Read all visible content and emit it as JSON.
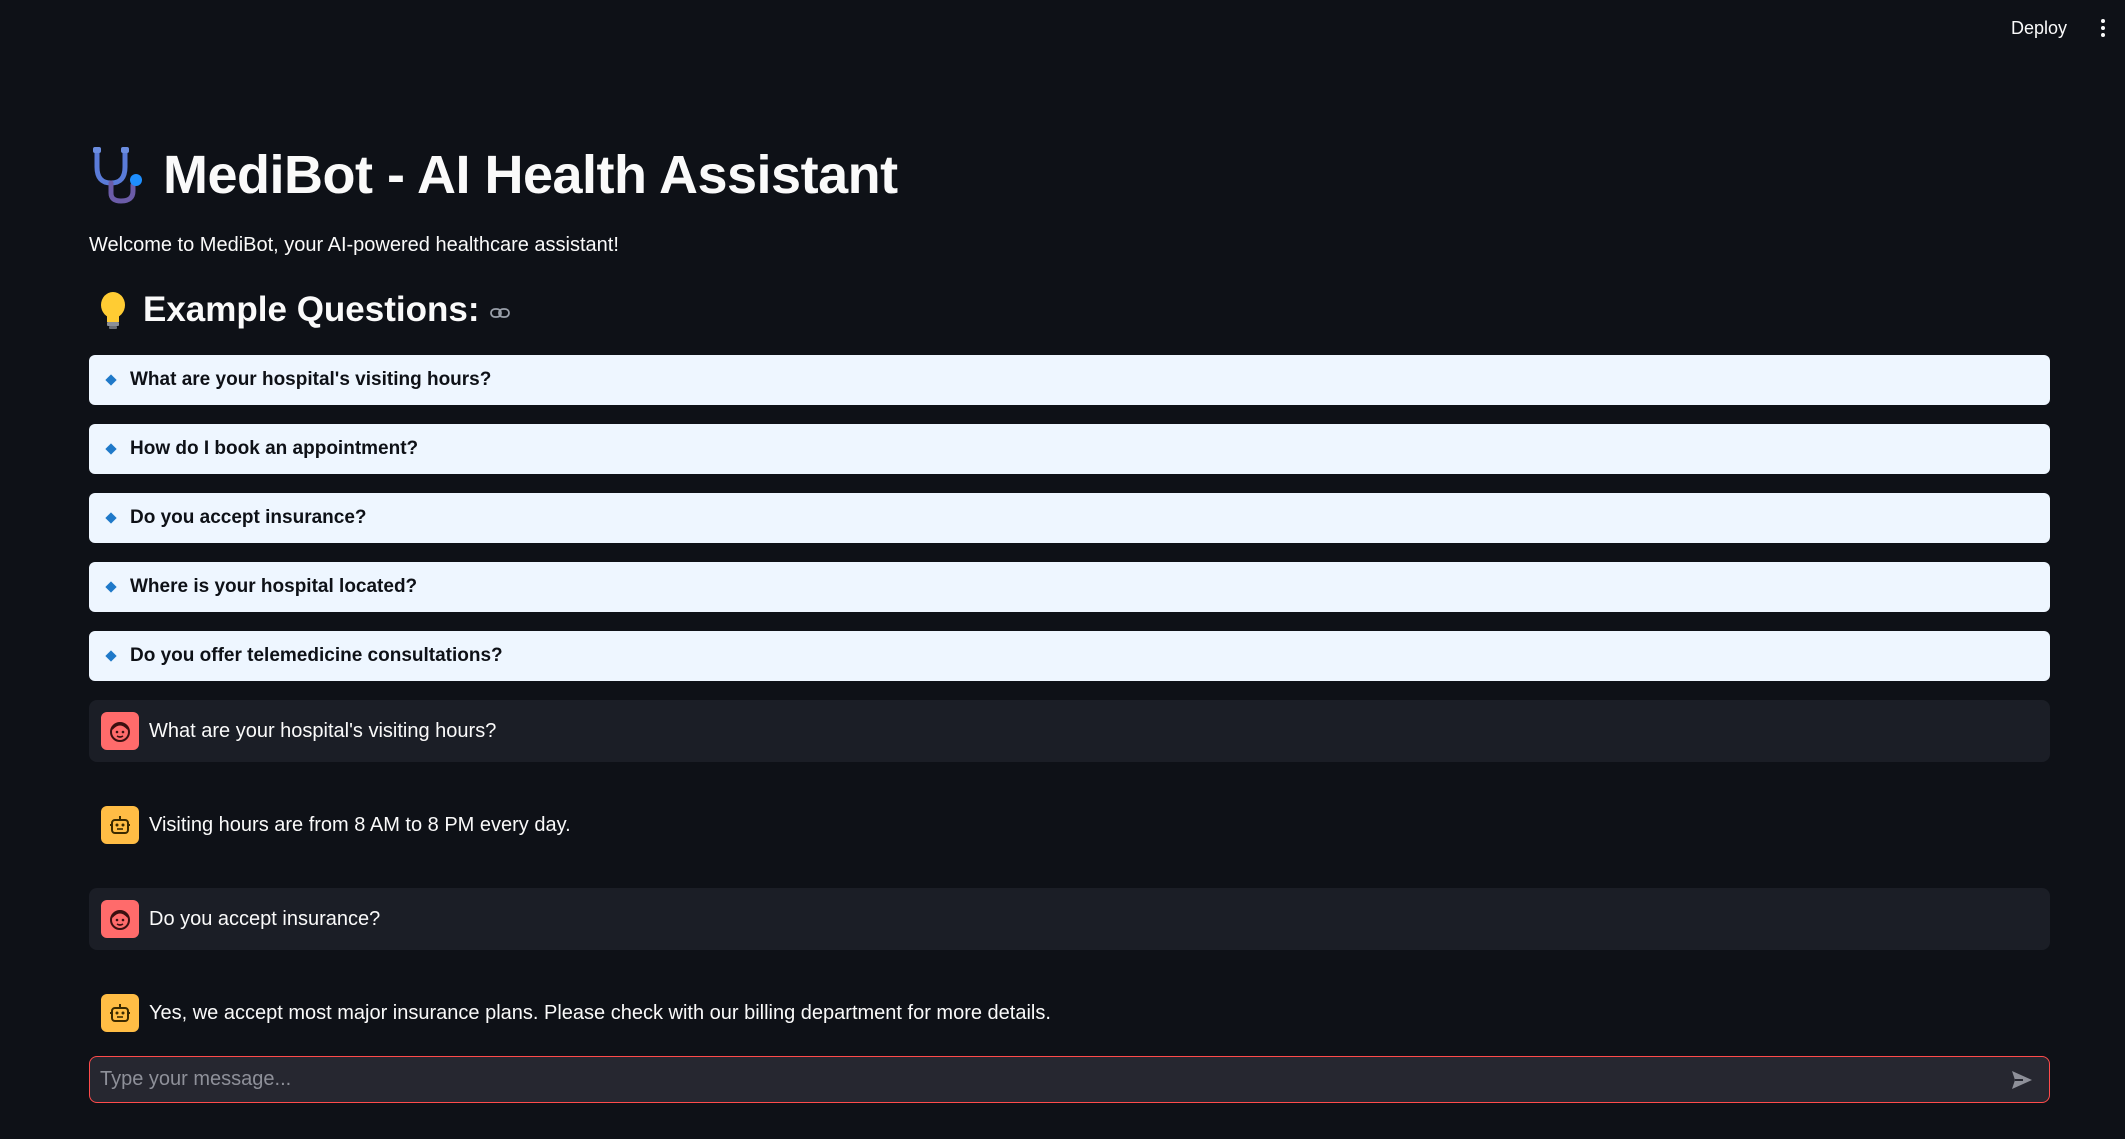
{
  "header": {
    "deploy_label": "Deploy",
    "menu_icon": "kebab-menu-icon"
  },
  "app": {
    "title": "MediBot - AI Health Assistant",
    "title_icon": "stethoscope-icon",
    "welcome": "Welcome to MediBot, your AI-powered healthcare assistant!"
  },
  "examples": {
    "heading": "Example Questions:",
    "heading_icon": "lightbulb-icon",
    "anchor_icon": "link-icon",
    "questions": [
      "What are your hospital's visiting hours?",
      "How do I book an appointment?",
      "Do you accept insurance?",
      "Where is your hospital located?",
      "Do you offer telemedicine consultations?"
    ]
  },
  "chat": {
    "messages": [
      {
        "role": "user",
        "text": "What are your hospital's visiting hours?"
      },
      {
        "role": "assistant",
        "text": "Visiting hours are from 8 AM to 8 PM every day."
      },
      {
        "role": "user",
        "text": "Do you accept insurance?"
      },
      {
        "role": "assistant",
        "text": "Yes, we accept most major insurance plans. Please check with our billing department for more details."
      }
    ],
    "input_placeholder": "Type your message...",
    "input_value": ""
  },
  "colors": {
    "background": "#0e1117",
    "question_button_bg": "#eef6ff",
    "user_avatar": "#ff6b6b",
    "assistant_avatar": "#ffbd45",
    "input_border": "#ff4b4b"
  }
}
